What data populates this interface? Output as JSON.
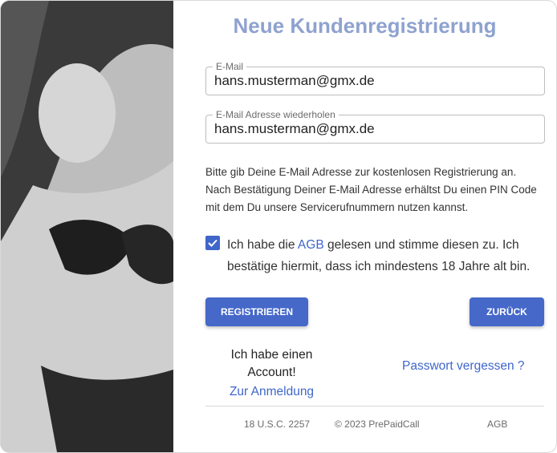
{
  "title": "Neue Kundenregistrierung",
  "email": {
    "label": "E-Mail",
    "value": "hans.musterman@gmx.de"
  },
  "email_repeat": {
    "label": "E-Mail Adresse wiederholen",
    "value": "hans.musterman@gmx.de"
  },
  "info_lines": [
    "Bitte gib Deine E-Mail Adresse zur kostenlosen Registrierung an.",
    "Nach Bestätigung Deiner E-Mail Adresse erhältst Du einen PIN Code",
    "mit dem Du unsere Servicerufnummern nutzen kannst."
  ],
  "agree": {
    "checked": true,
    "before": "Ich habe die ",
    "link": "AGB",
    "after": " gelesen und stimme diesen zu. Ich bestätige hiermit, dass ich mindestens 18 Jahre alt bin."
  },
  "buttons": {
    "register": "REGISTRIEREN",
    "back": "ZURÜCK"
  },
  "account": {
    "text": "Ich habe einen Account!",
    "link": "Zur Anmeldung"
  },
  "forgot": "Passwort vergessen ?",
  "footer": {
    "usc": "18 U.S.C. 2257",
    "copyright": "© 2023 PrePaidCall",
    "agb": "AGB"
  },
  "colors": {
    "accent": "#4568c9",
    "title": "#8fa2cf",
    "link": "#3f66c9"
  },
  "image": {
    "description_icon": "photo-icon"
  }
}
